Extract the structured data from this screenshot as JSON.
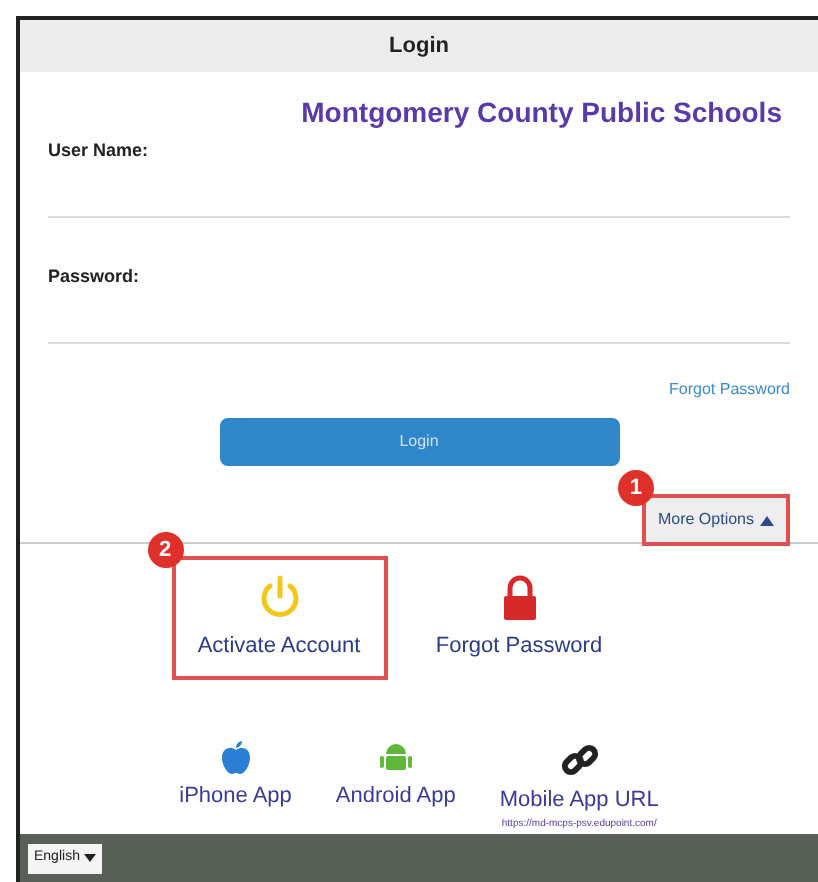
{
  "window": {
    "title": "Login"
  },
  "heading": "Montgomery County Public Schools",
  "fields": [
    {
      "label": "User Name:"
    },
    {
      "label": "Password:"
    }
  ],
  "forgot_link": "Forgot Password",
  "login_button": "Login",
  "more_options": {
    "label": "More Options",
    "expanded": true,
    "callout": "1"
  },
  "options": [
    {
      "kind": "power",
      "label": "Activate Account",
      "callout": "2"
    },
    {
      "kind": "lock",
      "label": "Forgot Password"
    }
  ],
  "apps": [
    {
      "kind": "apple",
      "label": "iPhone App"
    },
    {
      "kind": "android",
      "label": "Android App"
    },
    {
      "kind": "link",
      "label": "Mobile App URL",
      "url": "https://md-mcps-psv.edupoint.com/"
    }
  ],
  "language": "English"
}
